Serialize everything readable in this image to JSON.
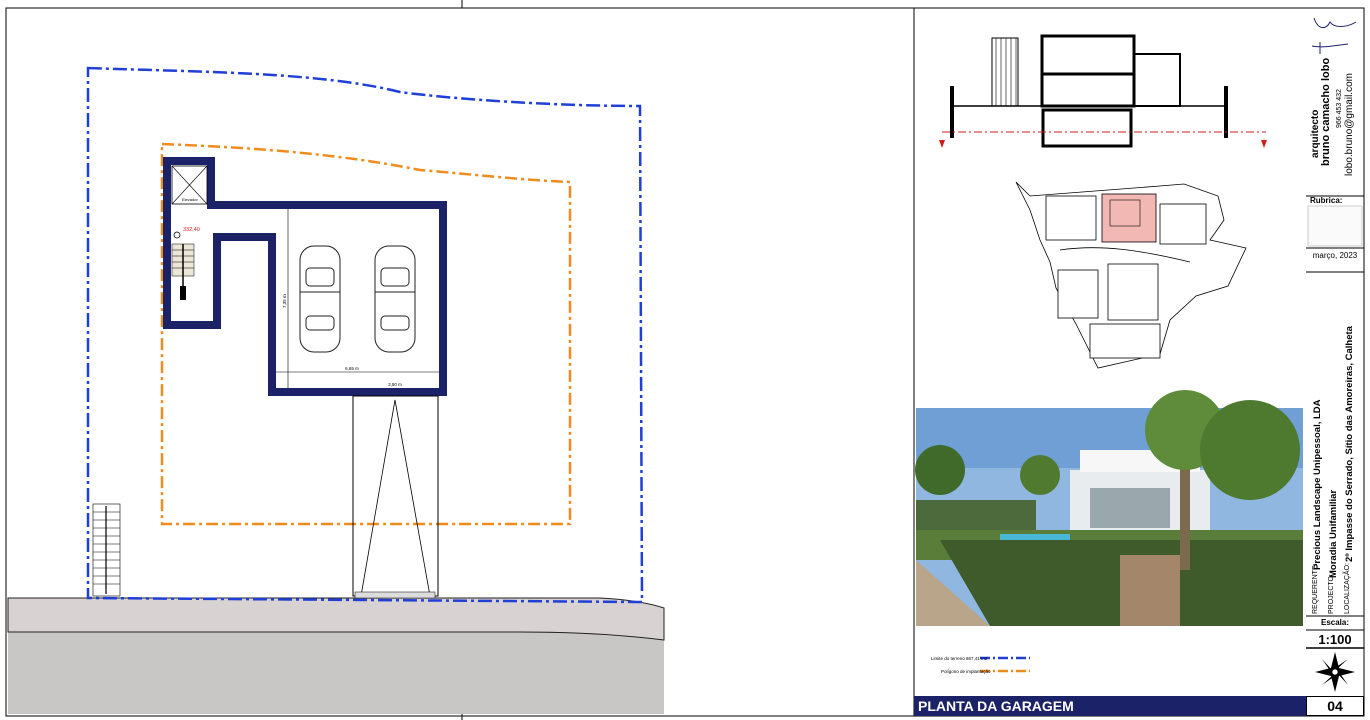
{
  "drawing": {
    "stair_elevation": "332,40",
    "elevator_label": "Elevador",
    "dim_width": "6,65 m",
    "dim_height": "7,35 m",
    "dim_ramp": "3,50 m"
  },
  "legend": {
    "terrain_limit": "Limite do terreno 867,41 m2",
    "implantation_polygon": "Polígono de implantação"
  },
  "title_block": {
    "role": "arquitecto",
    "architect_name": "bruno camacho lobo",
    "phone": "966 453 432",
    "email": "lobo.bruno@gmail.com",
    "rubrica_label": "Rubrica:",
    "date": "março, 2023",
    "requerente_label": "REQUERENTE:",
    "requerente_value": "Precious Landscape Unipessoal, LDA",
    "projecto_label": "PROJECTO:",
    "projecto_value": "Moradia Unifamiliar",
    "localizacao_label": "LOCALIZAÇÃO:",
    "localizacao_value": "2º Impasse do Serrado, Sítio das Amoreiras, Calheta",
    "escala_label": "Escala:",
    "escala_value": "1:100",
    "sheet_title": "PLANTA DA GARAGEM",
    "sheet_number": "04"
  },
  "colors": {
    "wall": "#1b2268",
    "terrain_line": "#1f3fd6",
    "implantation_line": "#f08c1e",
    "road": "#c9c6c6"
  }
}
